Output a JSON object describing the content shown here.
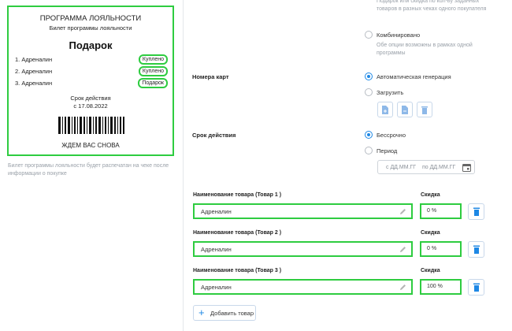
{
  "ticket": {
    "title": "ПРОГРАММА ЛОЯЛЬНОСТИ",
    "subtitle": "Билет программы лояльности",
    "heading": "Подарок",
    "rows": [
      {
        "name": "1. Адреналин",
        "status": "Куплено"
      },
      {
        "name": "2. Адреналин",
        "status": "Куплено"
      },
      {
        "name": "3. Адреналин",
        "status": "Подарок"
      }
    ],
    "valid_label": "Срок действия",
    "valid_from": "с 17.08.2022",
    "footer": "ЖДЕМ ВАС СНОВА"
  },
  "left_note": "Билет программы лояльности будет распечатан на чеке после информации о покупке",
  "top_hint": "Подарок или скидка по кол-ву заданных товаров в разных чеках одного покупателя",
  "combined": {
    "label": "Комбинировано",
    "hint": "Обе опции возможны в рамках одной программы"
  },
  "card_numbers": {
    "section_label": "Номера карт",
    "auto_label": "Автоматическая генерация",
    "upload_label": "Загрузить"
  },
  "validity": {
    "section_label": "Срок действия",
    "unlimited_label": "Бессрочно",
    "period_label": "Период",
    "from_placeholder": "с ДД.ММ.ГГ",
    "to_placeholder": "по ДД.ММ.ГГ"
  },
  "products": [
    {
      "label": "Наименование товара (Товар 1 )",
      "value": "Адреналин",
      "discount_label": "Скидка",
      "discount": "0 %"
    },
    {
      "label": "Наименование товара (Товар 2 )",
      "value": "Адреналин",
      "discount_label": "Скидка",
      "discount": "0 %"
    },
    {
      "label": "Наименование товара (Товар 3 )",
      "value": "Адреналин",
      "discount_label": "Скидка",
      "discount": "100 %"
    }
  ],
  "add_button": "Добавить товар",
  "colors": {
    "accent": "#1e88e5",
    "highlight": "#2ecc40",
    "muted": "#9aa1a9"
  },
  "icons": [
    "upload-file-icon",
    "upload-file-icon",
    "trash-icon",
    "calendar-icon",
    "pencil-icon",
    "plus-icon"
  ]
}
